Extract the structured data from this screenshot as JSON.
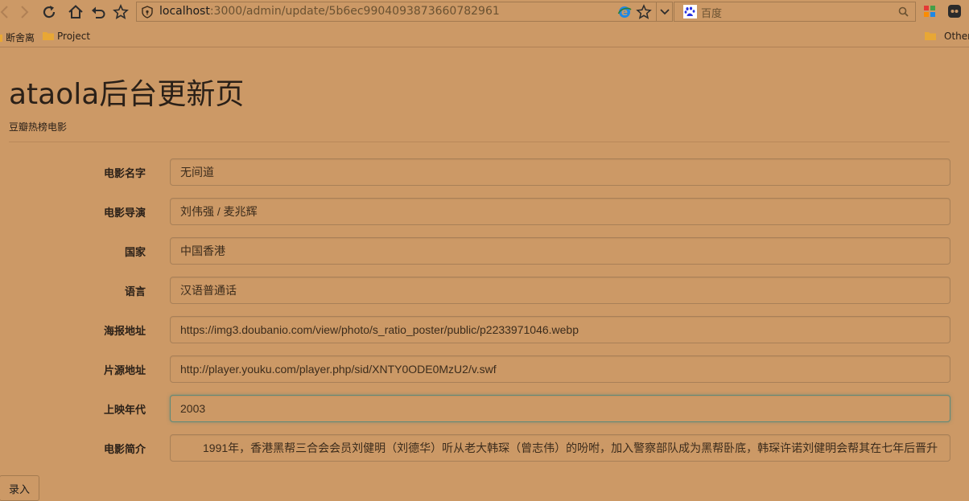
{
  "browser": {
    "url_host": "localhost",
    "url_rest": ":3000/admin/update/5b6ec9904093873660782961",
    "search_placeholder": "百度"
  },
  "bookmarks": {
    "items": [
      {
        "label": "断舍离"
      },
      {
        "label": "Project"
      }
    ],
    "other_label": "Other"
  },
  "page": {
    "title": "ataola后台更新页",
    "subtitle": "豆瓣热榜电影"
  },
  "form": {
    "fields": [
      {
        "label": "电影名字",
        "value": "无间道"
      },
      {
        "label": "电影导演",
        "value": "刘伟强 / 麦兆辉"
      },
      {
        "label": "国家",
        "value": "中国香港"
      },
      {
        "label": "语言",
        "value": "汉语普通话"
      },
      {
        "label": "海报地址",
        "value": "https://img3.doubanio.com/view/photo/s_ratio_poster/public/p2233971046.webp"
      },
      {
        "label": "片源地址",
        "value": "http://player.youku.com/player.php/sid/XNTY0ODE0MzU2/v.swf"
      },
      {
        "label": "上映年代",
        "value": "2003"
      },
      {
        "label": "电影简介",
        "value": "1991年，香港黑帮三合会会员刘健明（刘德华）听从老大韩琛（曾志伟）的吩咐，加入警察部队成为黑帮卧底，韩琛许诺刘健明会帮其在七年后晋升"
      }
    ],
    "submit_label": "录入"
  }
}
